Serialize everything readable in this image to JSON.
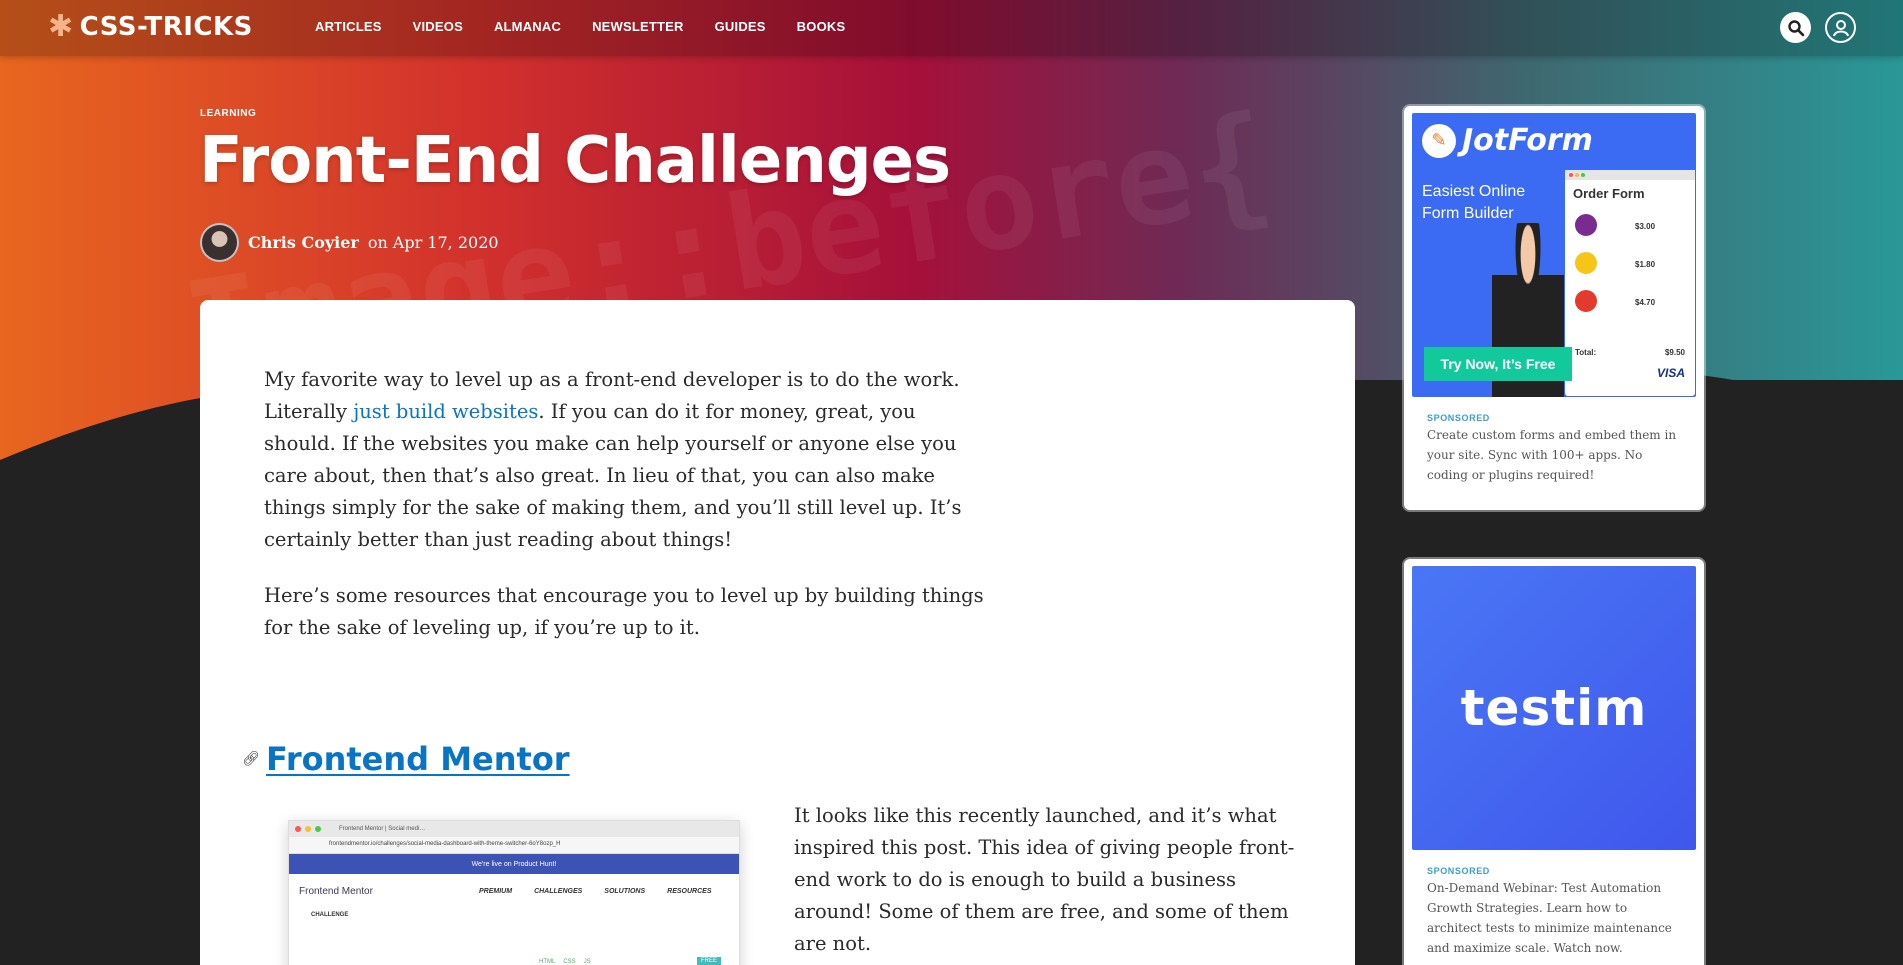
{
  "logo": "CSS-TRICKS",
  "nav": [
    "ARTICLES",
    "VIDEOS",
    "ALMANAC",
    "NEWSLETTER",
    "GUIDES",
    "BOOKS"
  ],
  "hero": {
    "category": "LEARNING",
    "title": "Front-End Challenges",
    "author": "Chris Coyier",
    "date_prefix": "on",
    "date": "Apr 17, 2020",
    "watermark": "Image::before{"
  },
  "article": {
    "p1_before_link": "My favorite way to level up as a front-end developer is to do the work. Literally ",
    "p1_link": "just build websites",
    "p1_after_link": ". If you can do it for money, great, you should. If the websites you make can help yourself or anyone else you care about, then that’s also great. In lieu of that, you can also make things simply for the sake of making them, and you’ll still level up. It’s certainly better than just reading about things!",
    "p2": "Here’s some resources that encourage you to level up by building things for the sake of leveling up, if you’re up to it.",
    "section_title": "Frontend Mentor",
    "section_text": "It looks like this recently launched, and it’s what inspired this post. This idea of giving people front-end work to do is enough to build a business around! Some of them are free, and some of them are not."
  },
  "screenshot": {
    "tab": "Frontend Mentor | Social medi…",
    "url": "frontendmentor.io/challenges/social-media-dashboard-with-theme-switcher-6oY8ozp_H",
    "banner": "We're live on Product Hunt!",
    "brand": "Frontend Mentor",
    "links": [
      "PREMIUM",
      "CHALLENGES",
      "SOLUTIONS",
      "RESOURCES"
    ],
    "challenge": "CHALLENGE",
    "tags": [
      "HTML",
      "CSS",
      "JS"
    ],
    "free": "FREE"
  },
  "ads": [
    {
      "label": "SPONSORED",
      "desc": "Create custom forms and embed them in your site. Sync with 100+ apps. No coding or plugins required!",
      "brand": "JotForm",
      "tagline": "Easiest Online Form Builder",
      "form_title": "Order Form",
      "prices": [
        "$3.00",
        "$1.80",
        "$4.70"
      ],
      "total_label": "Total:",
      "total": "$9.50",
      "visa": "VISA",
      "cta": "Try Now, It’s Free"
    },
    {
      "label": "SPONSORED",
      "desc": "On-Demand Webinar: Test Automation Growth Strategies. Learn how to architect tests to minimize maintenance and maximize scale. Watch now.",
      "brand": "testim"
    }
  ]
}
